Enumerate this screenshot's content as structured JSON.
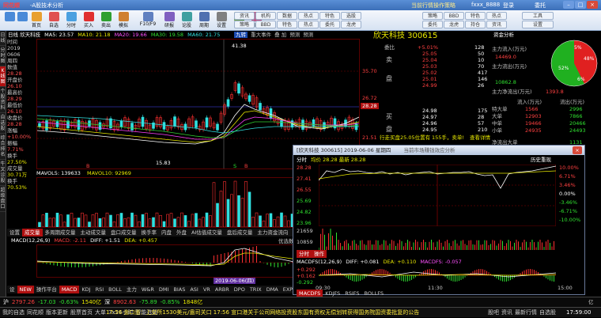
{
  "titlebar": {
    "logo": "同花顺",
    "suffix": "-A股技术分析",
    "center_link": "当前行情操作策略",
    "user": "fxxx_8888",
    "login": "登录",
    "ad": "委托"
  },
  "toolbar": {
    "buttons": [
      "首页",
      "自选",
      "分时",
      "买入",
      "卖出",
      "模拟",
      "F10/F9",
      "研报",
      "论股",
      "周期",
      "设置",
      "叠加",
      "画线",
      "九转",
      "分析",
      "操盘"
    ],
    "right_top": [
      "资讯",
      "机构",
      "数据",
      "热点",
      "特色",
      "选股",
      "工具",
      "设置"
    ],
    "right_bottom": [
      "策略",
      "BBD",
      "特色",
      "热点",
      "委托",
      "龙虎",
      "持仓",
      "资讯"
    ]
  },
  "left_tabs": [
    {
      "label": "日线",
      "active": false
    },
    {
      "label": "分时图",
      "active": false
    },
    {
      "label": "K线图",
      "active": true
    },
    {
      "label": "个股资料",
      "active": false
    },
    {
      "label": "自选股",
      "active": false
    },
    {
      "label": "综合排名",
      "active": false
    },
    {
      "label": "牛叉诊股",
      "active": false
    },
    {
      "label": "超级盘口",
      "active": false
    }
  ],
  "info_col": [
    {
      "t": "时间",
      "c": ""
    },
    {
      "t": "2019",
      "c": ""
    },
    {
      "t": "0606",
      "c": ""
    },
    {
      "t": "周四",
      "c": ""
    },
    {
      "t": "数值",
      "c": ""
    },
    {
      "t": "28.28",
      "c": "r"
    },
    {
      "t": "开盘价",
      "c": ""
    },
    {
      "t": "26.10",
      "c": "r"
    },
    {
      "t": "最高价",
      "c": ""
    },
    {
      "t": "28.29",
      "c": "r"
    },
    {
      "t": "最低价",
      "c": ""
    },
    {
      "t": "26.10",
      "c": "r"
    },
    {
      "t": "收盘价",
      "c": ""
    },
    {
      "t": "28.28",
      "c": "r"
    },
    {
      "t": "涨幅",
      "c": ""
    },
    {
      "t": "+10.00%",
      "c": "r"
    },
    {
      "t": "振幅",
      "c": ""
    },
    {
      "t": "7.71%",
      "c": "r"
    },
    {
      "t": "换手",
      "c": ""
    },
    {
      "t": "27.50%",
      "c": "y"
    },
    {
      "t": "成交量",
      "c": ""
    },
    {
      "t": "30.71万",
      "c": "y"
    },
    {
      "t": "换手",
      "c": ""
    },
    {
      "t": "70.53%",
      "c": "y"
    }
  ],
  "kline_header": {
    "prefix": "日线 欣天科技",
    "ma5": "MA5: 23.57",
    "ma10": "MA10: 21.18",
    "ma20": "MA20: 19.66",
    "ma30": "MA30: 19.58",
    "ma60": "MA60: 21.75",
    "tools": [
      "九转",
      "重大事件",
      "叠",
      "加",
      "预测",
      "预测"
    ]
  },
  "kline_labels": {
    "high_mark": "41.38",
    "low_mark": "15.83",
    "price_axis": [
      "35.70",
      "26.72",
      "21.51"
    ],
    "price_badge": "28.28",
    "markers": [
      "B",
      "S",
      "B"
    ]
  },
  "vol_header": {
    "a": "MAVOL5: 139633",
    "b": "MAVOL10: 92969"
  },
  "vol_tabs": [
    {
      "label": "设置",
      "on": false
    },
    {
      "label": "成交量",
      "on": true
    },
    {
      "label": "多周期成交量",
      "on": false
    },
    {
      "label": "主动成交量",
      "on": false
    },
    {
      "label": "盘口成交量",
      "on": false
    },
    {
      "label": "换手率",
      "on": false
    },
    {
      "label": "内盘",
      "on": false
    },
    {
      "label": "外盘",
      "on": false
    },
    {
      "label": "AI估值成交量",
      "on": false
    },
    {
      "label": "盘后成交量",
      "on": false
    },
    {
      "label": "主力资金流向",
      "on": false
    }
  ],
  "macd_header": {
    "a": "MACD(12,26,9)",
    "b": "MACD: -2.11",
    "c": "DIFF: +1.51",
    "d": "DEA: +0.457"
  },
  "macd_right": "优选数据",
  "date_badge": "2019-06-06(四)",
  "bottom_tabs": [
    {
      "label": "设",
      "on": false
    },
    {
      "label": "NEW",
      "on": true
    },
    {
      "label": "操作平台",
      "on": false
    },
    {
      "label": "MACD",
      "on": true
    },
    {
      "label": "KDJ",
      "on": false
    },
    {
      "label": "RSI",
      "on": false
    },
    {
      "label": "BOLL",
      "on": false
    },
    {
      "label": "主力",
      "on": false
    },
    {
      "label": "W&R",
      "on": false
    },
    {
      "label": "DMI",
      "on": false
    },
    {
      "label": "BIAS",
      "on": false
    },
    {
      "label": "ASI",
      "on": false
    },
    {
      "label": "VR",
      "on": false
    },
    {
      "label": "ARBR",
      "on": false
    },
    {
      "label": "DPO",
      "on": false
    },
    {
      "label": "TRIX",
      "on": false
    },
    {
      "label": "DMA",
      "on": false
    },
    {
      "label": "EXPMA",
      "on": false
    }
  ],
  "quote": {
    "name": "欣天科技 300615",
    "webi": "委比",
    "webi_val": "+5.01%",
    "webi_right": "128",
    "sell_label": [
      "卖",
      "盘"
    ],
    "buy_label": [
      "买",
      "盘"
    ],
    "sells": [
      {
        "p": "25.05",
        "v": "50"
      },
      {
        "p": "25.04",
        "v": "10"
      },
      {
        "p": "25.03",
        "v": "70"
      },
      {
        "p": "25.02",
        "v": "417"
      },
      {
        "p": "25.01",
        "v": "146"
      }
    ],
    "mid": {
      "p": "24.99",
      "v": "26"
    },
    "buys": [
      {
        "p": "24.98",
        "v": "175"
      },
      {
        "p": "24.97",
        "v": "28"
      },
      {
        "p": "24.96",
        "v": "57"
      },
      {
        "p": "24.95",
        "v": "210"
      }
    ],
    "footer_left": "行走买盘25.05位置有",
    "footer_mid": "155手，卖单!",
    "footer_right": "查看详情"
  },
  "fund": {
    "title": "资金分析",
    "inflow_label": "主力流入(万元)",
    "inflow_val": "14469.0",
    "outflow_label": "主力流出(万元)",
    "outflow_val": "10862.8",
    "net_label": "主力净流出(万元)",
    "net_val": "1393.8",
    "pie": [
      {
        "pct": "48%",
        "color": "#e02020"
      },
      {
        "pct": "52%",
        "color": "#20b020"
      },
      {
        "pct": "5%",
        "color": "#e02020"
      },
      {
        "pct": "6%",
        "color": "#20b020"
      }
    ],
    "table_head": [
      "流入(万元)",
      "流出(万元)"
    ],
    "rows": [
      {
        "k": "特大单",
        "in": "1566",
        "out": "2996"
      },
      {
        "k": "大单",
        "in": "12903",
        "out": "7866"
      },
      {
        "k": "中单",
        "in": "19466",
        "out": "20466"
      },
      {
        "k": "小单",
        "in": "24935",
        "out": "24493"
      }
    ],
    "last_row": "净流出大单",
    "last_val": "1131"
  },
  "intraday": {
    "title": "[欣天科技 300615] 2019-06-06 星期四",
    "subtitle": "当前市场赚钱效应分析",
    "header_left": "分时",
    "header_mid": "均价 28.28  最新 28.28",
    "header_right": "历史重现",
    "left_axis": [
      "28.28",
      "27.41",
      "26.55",
      "25.69",
      "24.82",
      "23.96"
    ],
    "right_axis": [
      "10.00%",
      "6.71%",
      "3.46%",
      "0.00%",
      "-3.46%",
      "-6.71%",
      "-10.00%"
    ],
    "vol_axis": [
      "21659",
      "10859"
    ],
    "macd_header": {
      "a": "MACDFS(12,26,9)",
      "b": "DIFF: +0.081",
      "c": "DEA: +0.110",
      "d": "MACDFS: -0.057"
    },
    "macd_axis": [
      "0.292",
      "0.162",
      "-0.292"
    ],
    "time_axis": [
      "09:30",
      "11:30",
      "15:00"
    ],
    "macd_left": [
      "+0.292",
      "+0.162",
      "-0.162",
      "-0.292"
    ],
    "tabs": [
      {
        "label": "MACDFS",
        "on": true
      },
      {
        "label": "KDJFS",
        "on": false
      },
      {
        "label": "RSIFS",
        "on": false
      },
      {
        "label": "BOLLFS",
        "on": false
      }
    ],
    "mini_tabs": [
      "分时",
      "操作"
    ]
  },
  "statusbar": {
    "items": [
      {
        "k": "沪",
        "v": "2797.26",
        "c": "red"
      },
      {
        "k": "",
        "v": "-17.03",
        "c": "green"
      },
      {
        "k": "",
        "v": "-0.63%",
        "c": "green"
      },
      {
        "k": "",
        "v": "1540亿",
        "c": "yellow"
      },
      {
        "k": "深",
        "v": "8902.63",
        "c": "red"
      },
      {
        "k": "",
        "v": "-75.89",
        "c": "green"
      },
      {
        "k": "",
        "v": "-0.85%",
        "c": "green"
      },
      {
        "k": "",
        "v": "1848亿",
        "c": "yellow"
      }
    ],
    "right_icon": "亿"
  },
  "bottombar": {
    "left": [
      "我的自选",
      "同花顺",
      "版本更新",
      "股票首页",
      "大单",
      "7x24小时",
      "智能选股"
    ],
    "news": "17:56 金口道：上交所1530美元/盎司关口  17:56 宣口港关于公司网络投资股东国有资权无偿划转获得国务院国资委批复的公告",
    "right": [
      "股吧",
      "资讯",
      "最新行情",
      "自选股"
    ],
    "time": "17:59:00"
  }
}
